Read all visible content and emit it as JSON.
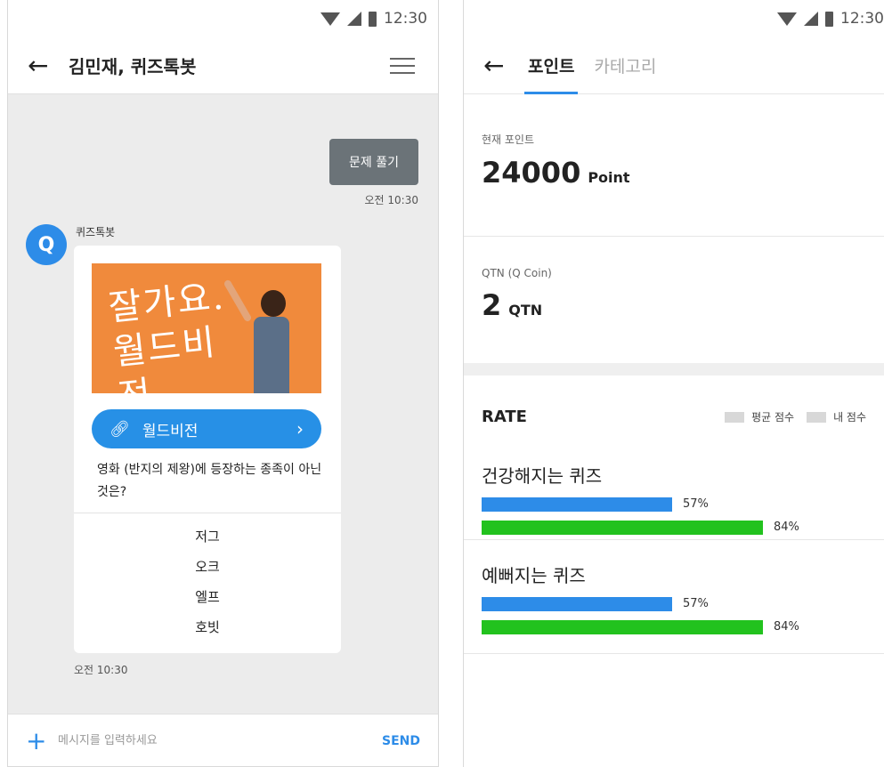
{
  "status_bar": {
    "time": "12:30"
  },
  "chat": {
    "title": "김민재, 퀴즈톡봇",
    "my_message": "문제 풀기",
    "my_time": "오전 10:30",
    "bot": {
      "avatar_glyph": "Q",
      "name": "퀴즈톡봇",
      "image_calligraphy": "잘가요. 월드비전",
      "link_label": "월드비전",
      "question": "영화 (반지의 제왕)에 등장하는 종족이 아닌것은?",
      "options": [
        "저그",
        "오크",
        "엘프",
        "호빗"
      ],
      "time": "오전 10:30"
    },
    "input": {
      "placeholder": "메시지를 입력하세요",
      "send_label": "SEND"
    }
  },
  "points": {
    "tabs": [
      {
        "label": "포인트",
        "active": true
      },
      {
        "label": "카테고리",
        "active": false
      }
    ],
    "current_points": {
      "label": "현재 포인트",
      "value": "24000",
      "unit": "Point"
    },
    "qtn": {
      "label": "QTN (Q Coin)",
      "value": "2",
      "unit": "QTN"
    },
    "rate": {
      "title": "RATE",
      "legend": [
        "평균 점수",
        "내 점수"
      ],
      "colors": {
        "average": "#2d8ce8",
        "mine": "#22c21e"
      },
      "quizzes": [
        {
          "name": "건강해지는 퀴즈",
          "average_pct": 57,
          "average_label": "57%",
          "mine_pct": 84,
          "mine_label": "84%"
        },
        {
          "name": "예뻐지는 퀴즈",
          "average_pct": 57,
          "average_label": "57%",
          "mine_pct": 84,
          "mine_label": "84%"
        }
      ]
    }
  }
}
